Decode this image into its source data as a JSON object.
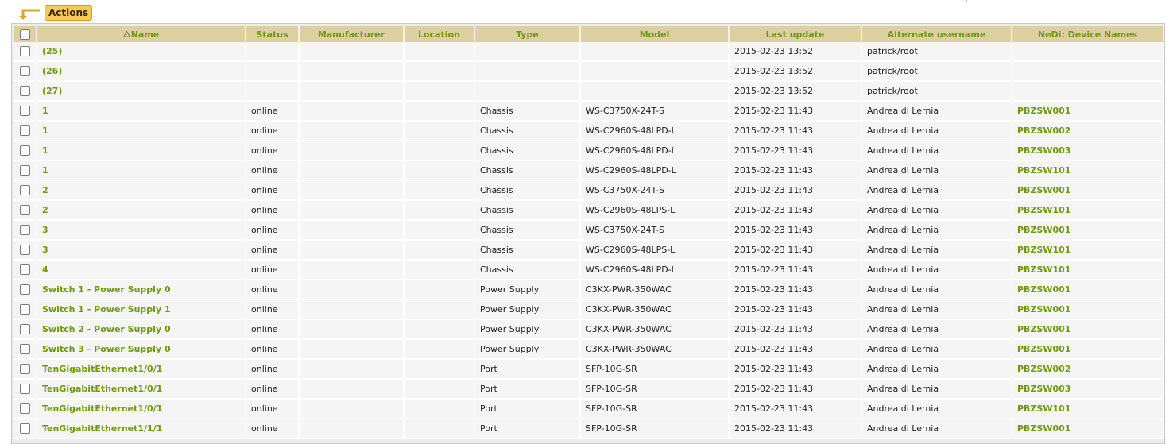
{
  "toolbar": {
    "actions_label": "Actions"
  },
  "table": {
    "columns": [
      "Name",
      "Status",
      "Manufacturer",
      "Location",
      "Type",
      "Model",
      "Last update",
      "Alternate username",
      "NeDi: Device Names"
    ],
    "rows": [
      {
        "name": "(25)",
        "status": "",
        "manufacturer": "",
        "location": "",
        "type": "",
        "model": "",
        "last_update": "2015-02-23 13:52",
        "alt_user": "patrick/root",
        "device": ""
      },
      {
        "name": "(26)",
        "status": "",
        "manufacturer": "",
        "location": "",
        "type": "",
        "model": "",
        "last_update": "2015-02-23 13:52",
        "alt_user": "patrick/root",
        "device": ""
      },
      {
        "name": "(27)",
        "status": "",
        "manufacturer": "",
        "location": "",
        "type": "",
        "model": "",
        "last_update": "2015-02-23 13:52",
        "alt_user": "patrick/root",
        "device": ""
      },
      {
        "name": "1",
        "status": "online",
        "manufacturer": "",
        "location": "",
        "type": "Chassis",
        "model": "WS-C3750X-24T-S",
        "last_update": "2015-02-23 11:43",
        "alt_user": "Andrea di Lernia",
        "device": "PBZSW001"
      },
      {
        "name": "1",
        "status": "online",
        "manufacturer": "",
        "location": "",
        "type": "Chassis",
        "model": "WS-C2960S-48LPD-L",
        "last_update": "2015-02-23 11:43",
        "alt_user": "Andrea di Lernia",
        "device": "PBZSW002"
      },
      {
        "name": "1",
        "status": "online",
        "manufacturer": "",
        "location": "",
        "type": "Chassis",
        "model": "WS-C2960S-48LPD-L",
        "last_update": "2015-02-23 11:43",
        "alt_user": "Andrea di Lernia",
        "device": "PBZSW003"
      },
      {
        "name": "1",
        "status": "online",
        "manufacturer": "",
        "location": "",
        "type": "Chassis",
        "model": "WS-C2960S-48LPD-L",
        "last_update": "2015-02-23 11:43",
        "alt_user": "Andrea di Lernia",
        "device": "PBZSW101"
      },
      {
        "name": "2",
        "status": "online",
        "manufacturer": "",
        "location": "",
        "type": "Chassis",
        "model": "WS-C3750X-24T-S",
        "last_update": "2015-02-23 11:43",
        "alt_user": "Andrea di Lernia",
        "device": "PBZSW001"
      },
      {
        "name": "2",
        "status": "online",
        "manufacturer": "",
        "location": "",
        "type": "Chassis",
        "model": "WS-C2960S-48LPS-L",
        "last_update": "2015-02-23 11:43",
        "alt_user": "Andrea di Lernia",
        "device": "PBZSW101"
      },
      {
        "name": "3",
        "status": "online",
        "manufacturer": "",
        "location": "",
        "type": "Chassis",
        "model": "WS-C3750X-24T-S",
        "last_update": "2015-02-23 11:43",
        "alt_user": "Andrea di Lernia",
        "device": "PBZSW001"
      },
      {
        "name": "3",
        "status": "online",
        "manufacturer": "",
        "location": "",
        "type": "Chassis",
        "model": "WS-C2960S-48LPS-L",
        "last_update": "2015-02-23 11:43",
        "alt_user": "Andrea di Lernia",
        "device": "PBZSW101"
      },
      {
        "name": "4",
        "status": "online",
        "manufacturer": "",
        "location": "",
        "type": "Chassis",
        "model": "WS-C2960S-48LPD-L",
        "last_update": "2015-02-23 11:43",
        "alt_user": "Andrea di Lernia",
        "device": "PBZSW101"
      },
      {
        "name": "Switch 1 - Power Supply 0",
        "status": "online",
        "manufacturer": "",
        "location": "",
        "type": "Power Supply",
        "model": "C3KX-PWR-350WAC",
        "last_update": "2015-02-23 11:43",
        "alt_user": "Andrea di Lernia",
        "device": "PBZSW001"
      },
      {
        "name": "Switch 1 - Power Supply 1",
        "status": "online",
        "manufacturer": "",
        "location": "",
        "type": "Power Supply",
        "model": "C3KX-PWR-350WAC",
        "last_update": "2015-02-23 11:43",
        "alt_user": "Andrea di Lernia",
        "device": "PBZSW001"
      },
      {
        "name": "Switch 2 - Power Supply 0",
        "status": "online",
        "manufacturer": "",
        "location": "",
        "type": "Power Supply",
        "model": "C3KX-PWR-350WAC",
        "last_update": "2015-02-23 11:43",
        "alt_user": "Andrea di Lernia",
        "device": "PBZSW001"
      },
      {
        "name": "Switch 3 - Power Supply 0",
        "status": "online",
        "manufacturer": "",
        "location": "",
        "type": "Power Supply",
        "model": "C3KX-PWR-350WAC",
        "last_update": "2015-02-23 11:43",
        "alt_user": "Andrea di Lernia",
        "device": "PBZSW001"
      },
      {
        "name": "TenGigabitEthernet1/0/1",
        "status": "online",
        "manufacturer": "",
        "location": "",
        "type": "Port",
        "model": "SFP-10G-SR",
        "last_update": "2015-02-23 11:43",
        "alt_user": "Andrea di Lernia",
        "device": "PBZSW002"
      },
      {
        "name": "TenGigabitEthernet1/0/1",
        "status": "online",
        "manufacturer": "",
        "location": "",
        "type": "Port",
        "model": "SFP-10G-SR",
        "last_update": "2015-02-23 11:43",
        "alt_user": "Andrea di Lernia",
        "device": "PBZSW003"
      },
      {
        "name": "TenGigabitEthernet1/0/1",
        "status": "online",
        "manufacturer": "",
        "location": "",
        "type": "Port",
        "model": "SFP-10G-SR",
        "last_update": "2015-02-23 11:43",
        "alt_user": "Andrea di Lernia",
        "device": "PBZSW101"
      },
      {
        "name": "TenGigabitEthernet1/1/1",
        "status": "online",
        "manufacturer": "",
        "location": "",
        "type": "Port",
        "model": "SFP-10G-SR",
        "last_update": "2015-02-23 11:43",
        "alt_user": "Andrea di Lernia",
        "device": "PBZSW001"
      }
    ]
  },
  "colors": {
    "header_bg": "#dcd09e",
    "link_green": "#6e9a0a",
    "actions_bg": "#f7c95a"
  }
}
